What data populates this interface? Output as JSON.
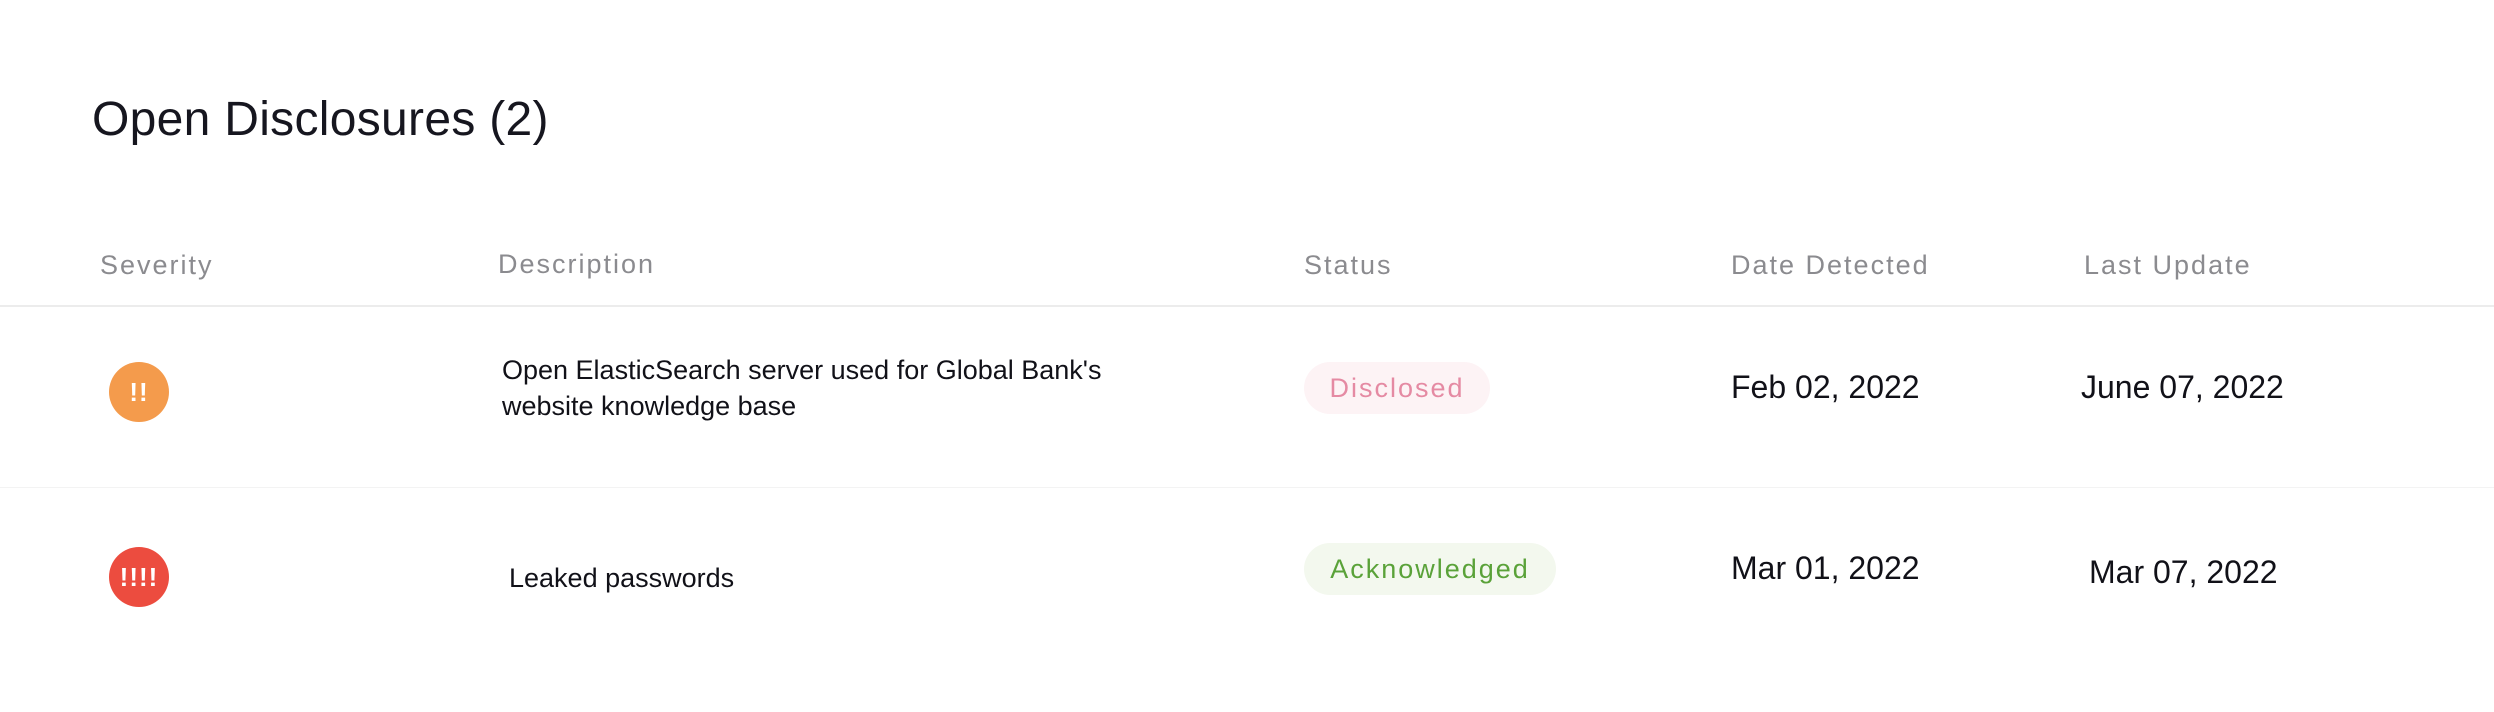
{
  "page": {
    "title": "Open Disclosures (2)"
  },
  "table": {
    "columns": [
      "Severity",
      "Description",
      "Status",
      "Date Detected",
      "Last Update"
    ],
    "rows": [
      {
        "severity": {
          "glyph": "!!",
          "level": "high",
          "color": "#f49b4c"
        },
        "description": "Open ElasticSearch server used for Global Bank's website knowledge base",
        "status": {
          "label": "Disclosed",
          "text_color": "#e58aa3",
          "bg_color": "#fdf3f5"
        },
        "date_detected": "Feb 02, 2022",
        "last_update": "June 07, 2022"
      },
      {
        "severity": {
          "glyph": "!!!!",
          "level": "critical",
          "color": "#ec4c3f"
        },
        "description": "Leaked passwords",
        "status": {
          "label": "Acknowledged",
          "text_color": "#5aa239",
          "bg_color": "#f3f8ee"
        },
        "date_detected": "Mar 01, 2022",
        "last_update": "Mar 07, 2022"
      }
    ]
  }
}
